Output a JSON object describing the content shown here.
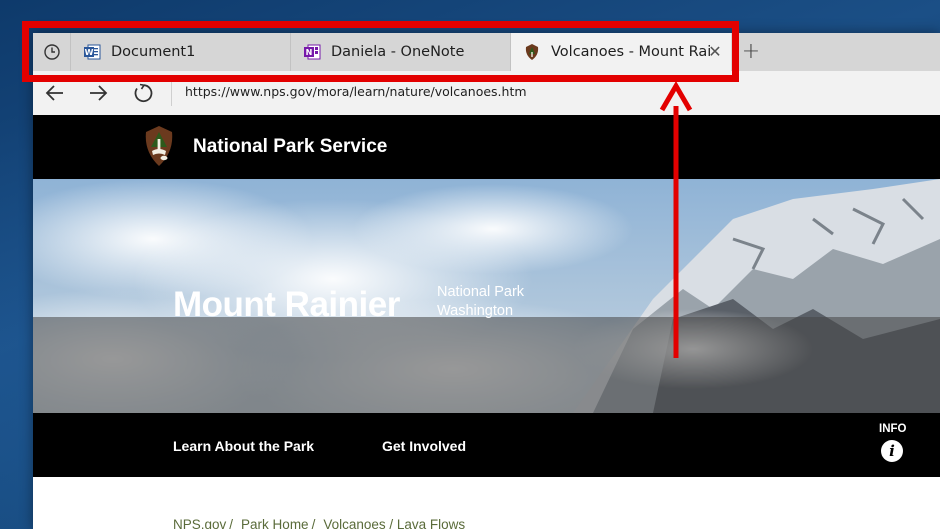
{
  "browser": {
    "tabs": [
      {
        "label": "Document1",
        "icon": "word-icon"
      },
      {
        "label": "Daniela - OneNote",
        "icon": "onenote-icon"
      },
      {
        "label": "Volcanoes - Mount Rai",
        "icon": "nps-arrowhead-icon",
        "active": true
      }
    ],
    "close_glyph": "✕",
    "new_tab_glyph": "+",
    "address": "https://www.nps.gov/mora/learn/nature/volcanoes.htm"
  },
  "site": {
    "name": "National Park Service",
    "park_name": "Mount Rainier",
    "park_type": "National Park",
    "park_state": "Washington",
    "nav": [
      "Learn About the Park",
      "Get Involved"
    ],
    "info_label": "INFO",
    "info_glyph": "i",
    "breadcrumb": [
      "NPS.gov",
      "Park Home",
      "Volcanoes / Lava Flows"
    ]
  },
  "colors": {
    "annotation": "#e30000",
    "header_bg": "#000000",
    "breadcrumb": "#5a6b3a"
  }
}
